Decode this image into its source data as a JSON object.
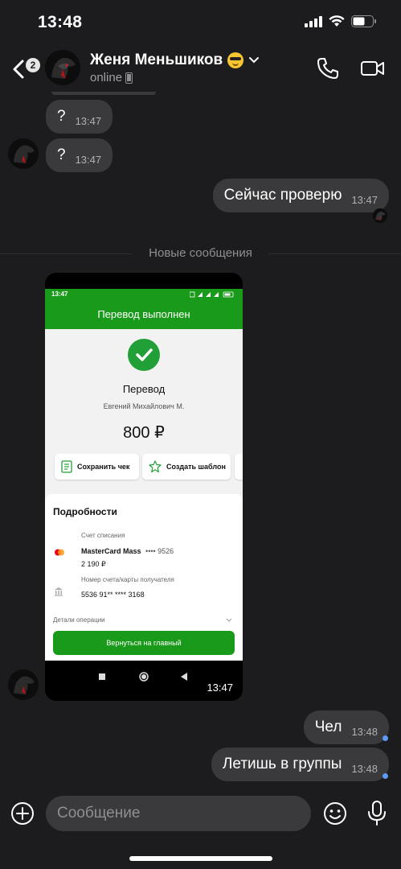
{
  "status_bar": {
    "time": "13:48"
  },
  "header": {
    "back_badge": "2",
    "contact_name": "Женя Меньшиков",
    "contact_status": "online"
  },
  "messages": {
    "m1": {
      "text": "?",
      "time": "13:47"
    },
    "m2": {
      "text": "?",
      "time": "13:47"
    },
    "m3": {
      "text": "Сейчас проверю",
      "time": "13:47"
    },
    "divider": "Новые сообщения",
    "screenshot": {
      "time": "13:47",
      "phone_status_time": "13:47",
      "title": "Перевод выполнен",
      "heading": "Перевод",
      "recipient": "Евгений Михайлович М.",
      "amount": "800 ₽",
      "save_check": "Сохранить чек",
      "create_template": "Создать шаблон",
      "details_title": "Подробности",
      "debit_label": "Счет списания",
      "card_name": "MasterCard Mass",
      "card_mask": "•••• 9526",
      "balance": "2 190 ₽",
      "recipient_label": "Номер счета/карты получателя",
      "recipient_card": "5536 91** **** 3168",
      "operation_details": "Детали операции",
      "home_button": "Вернуться на главный"
    },
    "m4": {
      "text": "Чел",
      "time": "13:48"
    },
    "m5": {
      "text": "Летишь в группы",
      "time": "13:48"
    }
  },
  "input": {
    "placeholder": "Сообщение"
  },
  "colors": {
    "accent_green": "#1a9a1a",
    "unread_dot": "#5b9bf5",
    "bubble": "#3a3a3c"
  }
}
